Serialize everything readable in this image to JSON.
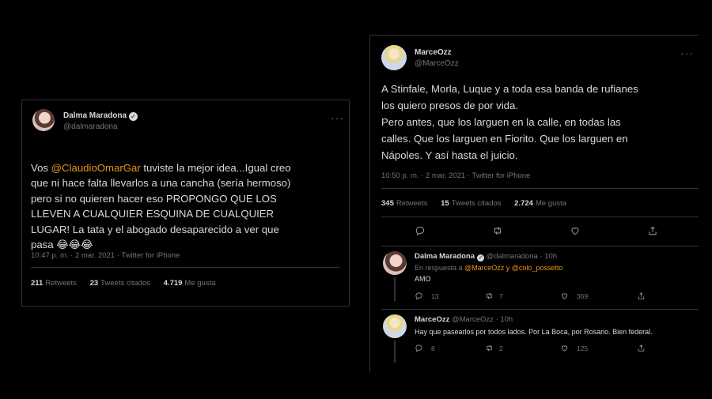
{
  "left_tweet": {
    "name": "Dalma Maradona",
    "handle": "@dalmaradona",
    "text_mention": "@ClaudioOmarGar",
    "text_prefix": "Vos ",
    "text_line1_rest": " tuviste la mejor idea...Igual creo",
    "text_rest": "que ni hace falta llevarlos a una cancha (sería hermoso)\npero si no quieren hacer eso PROPONGO QUE LOS\nLLEVEN A CUALQUIER ESQUINA DE CUALQUIER\nLUGAR! La tata y el abogado desaparecido a ver que\npasa 😂😂😂",
    "meta": "10:47 p. m. · 2 mar. 2021 · Twitter for iPhone",
    "retweets": "211",
    "retweets_label": "Retweets",
    "quotes": "23",
    "quotes_label": "Tweets citados",
    "likes": "4.719",
    "likes_label": "Me gusta"
  },
  "right_tweet": {
    "name": "MarceOzz",
    "handle": "@MarceOzz",
    "text": "A Stinfale, Morla, Luque y a toda esa banda de rufianes\nlos quiero presos de por vida.\nPero antes, que los larguen en la calle, en todas las\ncalles. Que los larguen en Fiorito. Que los larguen en\nNápoles. Y así hasta el juicio.",
    "meta": "10:50 p. m. · 2 mar. 2021 · Twitter for iPhone",
    "retweets": "345",
    "retweets_label": "Retweets",
    "quotes": "15",
    "quotes_label": "Tweets citados",
    "likes": "2.724",
    "likes_label": "Me gusta"
  },
  "reply1": {
    "name": "Dalma Maradona",
    "handle": "@dalmaradona · 10h",
    "in_reply_prefix": "En respuesta a ",
    "in_reply_mentions": "@MarceOzz y @colo_possetto",
    "text": "AMO",
    "replies": "13",
    "retweets": "7",
    "likes": "369"
  },
  "reply2": {
    "name": "MarceOzz",
    "handle": "@MarceOzz · 10h",
    "text": "Hay que pasearlos por todos lados. Por La Boca, por Rosario. Bien federal.",
    "replies": "8",
    "retweets": "2",
    "likes": "125"
  },
  "icons": {
    "more": "more-icon",
    "reply": "reply-icon",
    "retweet": "retweet-icon",
    "like": "heart-icon",
    "share": "share-icon",
    "verified": "verified-icon"
  },
  "colors": {
    "background": "#000000",
    "text": "#d9d9d9",
    "muted": "#6e767d",
    "mention": "#e8951c",
    "border": "#2f3336"
  }
}
